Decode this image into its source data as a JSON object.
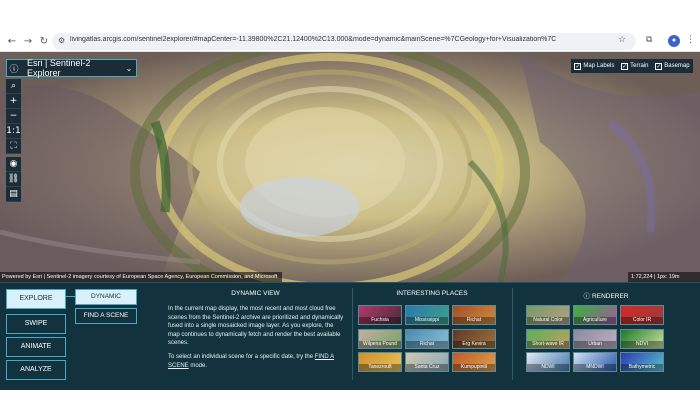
{
  "browser": {
    "url": "livingatlas.arcgis.com/sentinel2explorer/#mapCenter=-11.39800%2C21.12400%2C13.000&mode=dynamic&mainScene=%7CGeology+for+Visualization%7C"
  },
  "app": {
    "title": "Esri | Sentinel-2 Explorer"
  },
  "map_layers": {
    "labels": "Map Labels",
    "terrain": "Terrain",
    "basemap": "Basemap"
  },
  "attribution": "Powered by Esri | Sentinel-2 imagery courtesy of European Space Agency, European Commission, and Microsoft",
  "scale": "1:72,224 | 1px: 19m",
  "nav_tabs": {
    "explore": "EXPLORE",
    "swipe": "SWIPE",
    "animate": "ANIMATE",
    "analyze": "ANALYZE"
  },
  "modes": {
    "dynamic": "DYNAMIC",
    "find_scene": "FIND A SCENE"
  },
  "dynamic_view": {
    "title": "DYNAMIC VIEW",
    "text1": "In the current map display, the most recent and most cloud free scenes from the Sentinel-2 archive are prioritized and dynamically fused into a single mosaicked image layer. As you explore, the map continues to dynamically fetch and render the best available scenes.",
    "text2_a": "To select an individual scene for a specific date, try the ",
    "text2_link": "FIND A SCENE",
    "text2_b": " mode."
  },
  "interesting_places": {
    "title": "INTERESTING PLACES",
    "items": [
      "Fuchsia",
      "Mississippi",
      "Richat",
      "Wilpena Pound",
      "Richat",
      "Erg Kevira",
      "Tanezrouft",
      "Santa Cruz",
      "Kumpupintil"
    ]
  },
  "renderer": {
    "title": "RENDERER",
    "items": [
      "Natural Color",
      "Agriculture",
      "Color IR",
      "Short-wave IR",
      "Urban",
      "NDVI",
      "NDWI",
      "MNDWI",
      "Bathymetric"
    ]
  },
  "colors": {
    "panel_bg": "#12323e",
    "accent": "#4aa8c8",
    "active_bg": "#d9f1fa"
  }
}
